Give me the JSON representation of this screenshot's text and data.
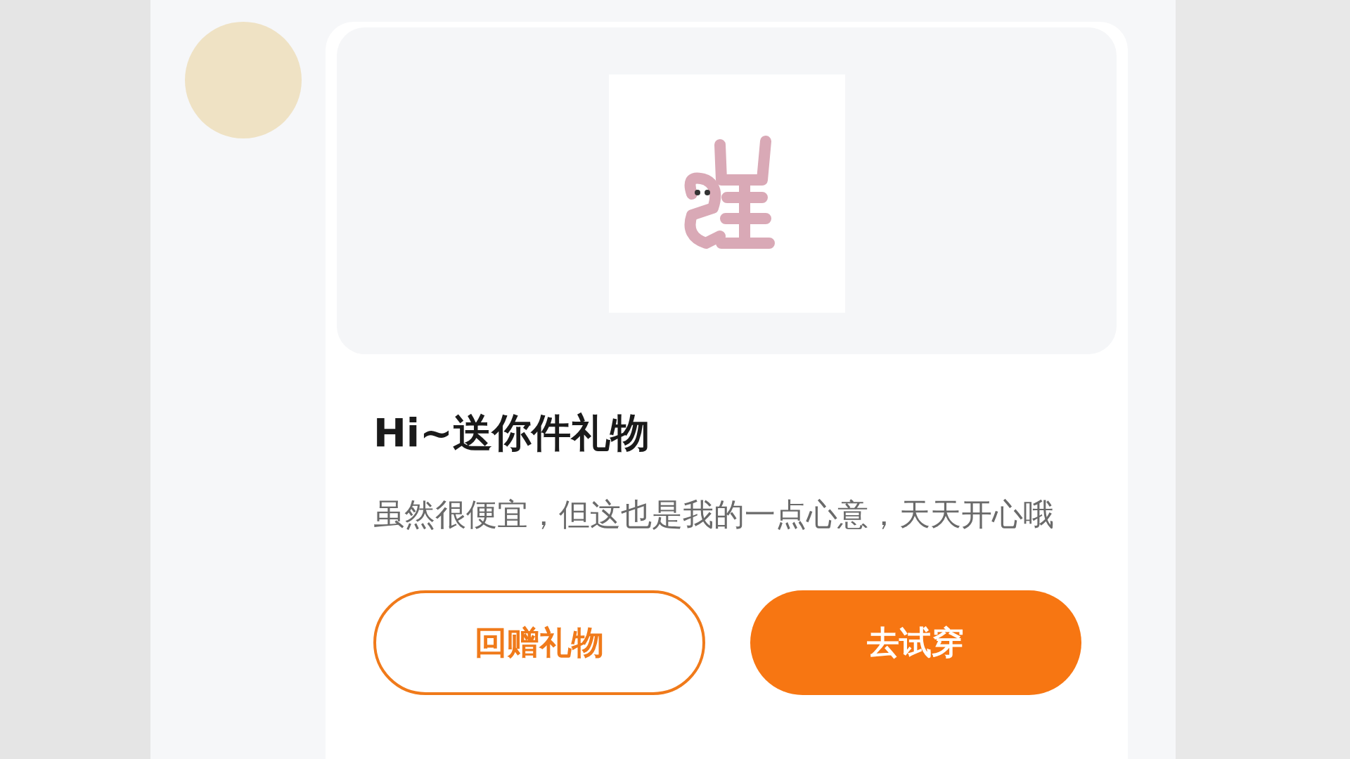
{
  "message": {
    "title": "Hi~送你件礼物",
    "body": "虽然很便宜，但这也是我的一点心意，天天开心哦"
  },
  "buttons": [
    {
      "label": "回赠礼物",
      "kind": "outline"
    },
    {
      "label": "去试穿",
      "kind": "filled"
    }
  ]
}
